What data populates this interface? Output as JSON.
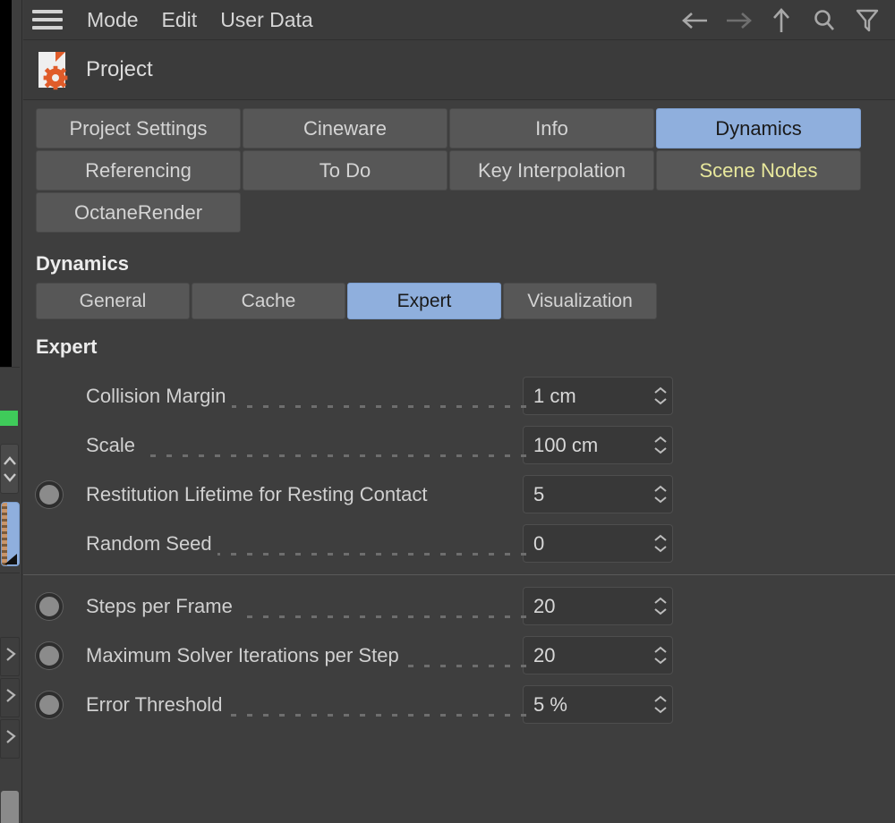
{
  "menubar": {
    "hamburger": "menu-icon",
    "items": [
      {
        "label": "Mode"
      },
      {
        "label": "Edit"
      },
      {
        "label": "User Data"
      }
    ],
    "right_icons": [
      {
        "name": "back-arrow-icon",
        "enabled": true
      },
      {
        "name": "forward-arrow-icon",
        "enabled": false
      },
      {
        "name": "up-arrow-icon",
        "enabled": true
      },
      {
        "name": "search-icon",
        "enabled": true
      },
      {
        "name": "filter-icon",
        "enabled": true
      }
    ]
  },
  "object_header": {
    "icon": "project-document-gear-icon",
    "title": "Project"
  },
  "tabs": [
    {
      "label": "Project Settings",
      "state": "normal"
    },
    {
      "label": "Cineware",
      "state": "normal"
    },
    {
      "label": "Info",
      "state": "normal"
    },
    {
      "label": "Dynamics",
      "state": "selected"
    },
    {
      "label": "Referencing",
      "state": "normal"
    },
    {
      "label": "To Do",
      "state": "normal"
    },
    {
      "label": "Key Interpolation",
      "state": "normal"
    },
    {
      "label": "Scene Nodes",
      "state": "accent"
    },
    {
      "label": "OctaneRender",
      "state": "normal"
    }
  ],
  "section": {
    "title": "Dynamics",
    "subtabs": [
      {
        "label": "General",
        "state": "normal"
      },
      {
        "label": "Cache",
        "state": "normal"
      },
      {
        "label": "Expert",
        "state": "selected"
      },
      {
        "label": "Visualization",
        "state": "normal"
      }
    ]
  },
  "panel": {
    "title": "Expert",
    "group_a": [
      {
        "label": "Collision Margin",
        "value": "1 cm",
        "radio": false,
        "leader": true
      },
      {
        "label": "Scale",
        "value": "100 cm",
        "radio": false,
        "leader": true
      },
      {
        "label": "Restitution Lifetime for Resting Contact",
        "value": "5",
        "radio": true,
        "leader": false
      },
      {
        "label": "Random Seed",
        "value": "0",
        "radio": false,
        "leader": true
      }
    ],
    "group_b": [
      {
        "label": "Steps per Frame",
        "value": "20",
        "radio": true,
        "leader": true
      },
      {
        "label": "Maximum Solver Iterations per Step",
        "value": "20",
        "radio": true,
        "leader": true
      },
      {
        "label": "Error Threshold",
        "value": "5 %",
        "radio": true,
        "leader": true
      }
    ]
  },
  "colors": {
    "background": "#3e3e3e",
    "panel_header": "#3b3b3b",
    "tab": "#575757",
    "tab_selected": "#8fafdd",
    "accent_text": "#e7e79c",
    "field": "#383838",
    "text": "#d4d4d4",
    "icon_orange": "#e05c2a",
    "strip_green": "#3fcb5a"
  },
  "left_strip": {
    "green_marker": "green-status-bar",
    "selected_item": "selected-thumbnail",
    "spinner": "strip-spinner"
  }
}
